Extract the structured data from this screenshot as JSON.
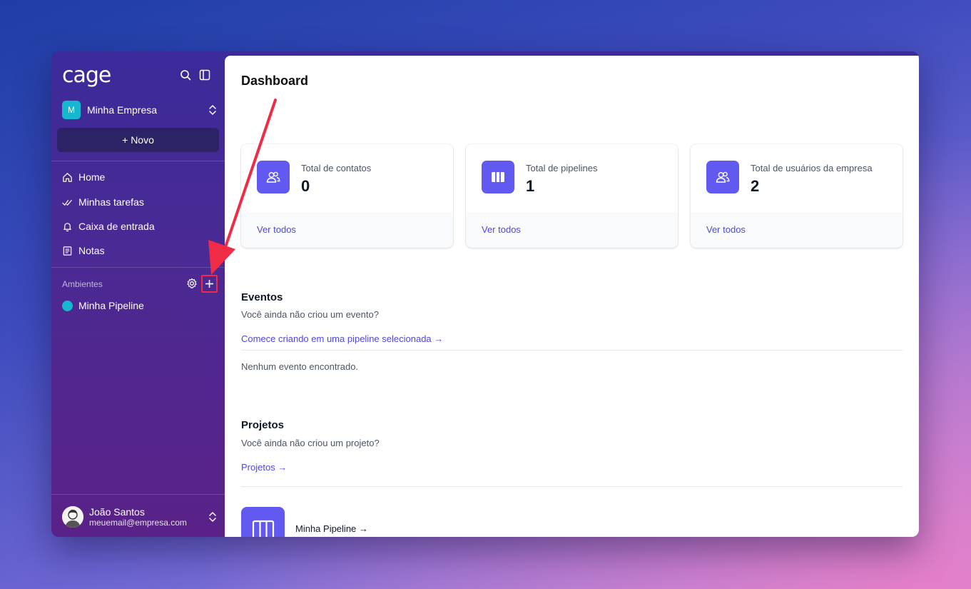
{
  "sidebar": {
    "logo": "cage",
    "company": {
      "initial": "M",
      "name": "Minha Empresa"
    },
    "new_button": "+ Novo",
    "nav": [
      {
        "label": "Home",
        "icon": "home-icon"
      },
      {
        "label": "Minhas tarefas",
        "icon": "check-icon"
      },
      {
        "label": "Caixa de entrada",
        "icon": "bell-icon"
      },
      {
        "label": "Notas",
        "icon": "notes-icon"
      }
    ],
    "section_label": "Ambientes",
    "pipelines": [
      {
        "label": "Minha Pipeline",
        "color": "#15b8cf"
      }
    ],
    "user": {
      "name": "João Santos",
      "email": "meuemail@empresa.com"
    }
  },
  "main": {
    "title": "Dashboard",
    "cards": [
      {
        "label": "Total de contatos",
        "value": "0",
        "link": "Ver todos",
        "icon": "users-icon"
      },
      {
        "label": "Total de pipelines",
        "value": "1",
        "link": "Ver todos",
        "icon": "columns-icon"
      },
      {
        "label": "Total de usuários da empresa",
        "value": "2",
        "link": "Ver todos",
        "icon": "users-icon"
      }
    ],
    "events": {
      "title": "Eventos",
      "subtitle": "Você ainda não criou um evento?",
      "link": "Comece criando em uma pipeline selecionada →",
      "empty": "Nenhum evento encontrado."
    },
    "projects": {
      "title": "Projetos",
      "subtitle": "Você ainda não criou um projeto?",
      "link": "Projetos →",
      "items": [
        {
          "name": "Minha Pipeline →"
        }
      ]
    }
  },
  "colors": {
    "accent": "#6159f0",
    "link": "#4f46e5",
    "annotation": "#ef2b45",
    "company_avatar": "#15b8cf"
  }
}
